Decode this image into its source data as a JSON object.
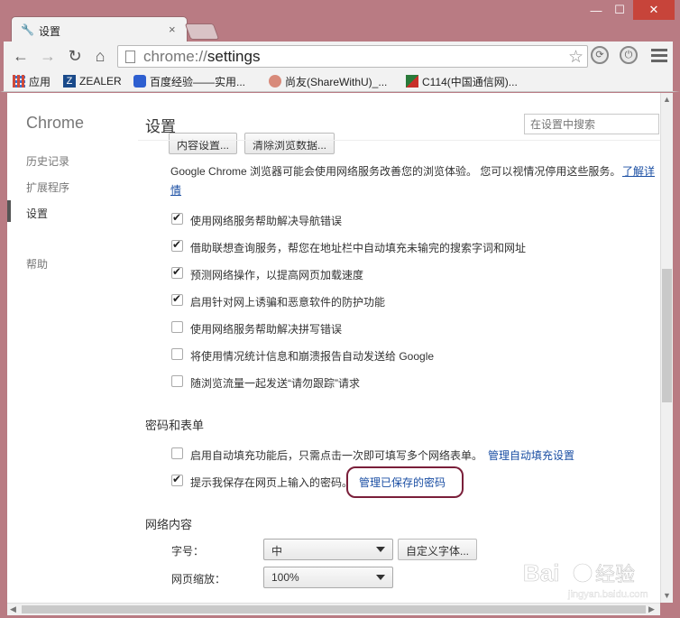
{
  "window": {
    "tab_title": "设置",
    "minimize": "—",
    "maximize": "☐",
    "close": "✕"
  },
  "toolbar": {
    "url_scheme": "chrome://",
    "url_path": "settings"
  },
  "bookmarks": [
    {
      "label": "应用",
      "icon": "apps-grid-icon"
    },
    {
      "label": "ZEALER",
      "icon": "zealer-icon"
    },
    {
      "label": "百度经验——实用...",
      "icon": "baidu-paw-icon"
    },
    {
      "label": "尚友(ShareWithU)_...",
      "icon": "sharewithu-icon"
    },
    {
      "label": "C114(中国通信网)...",
      "icon": "c114-icon"
    }
  ],
  "nav": {
    "brand": "Chrome",
    "items": [
      "历史记录",
      "扩展程序",
      "设置",
      "帮助"
    ]
  },
  "main": {
    "title": "设置",
    "search_placeholder": "在设置中搜索",
    "buttons_top": [
      "内容设置...",
      "清除浏览数据..."
    ],
    "privacy_note_1": "Google Chrome 浏览器可能会使用网络服务改善您的浏览体验。 您可以视情况停用这些服务。",
    "privacy_link_a": "了解详",
    "privacy_link_b": "情",
    "privacy_options": [
      {
        "label": "使用网络服务帮助解决导航错误",
        "checked": true
      },
      {
        "label": "借助联想查询服务，帮您在地址栏中自动填充未输完的搜索字词和网址",
        "checked": true
      },
      {
        "label": "预测网络操作，以提高网页加载速度",
        "checked": true
      },
      {
        "label": "启用针对网上诱骗和恶意软件的防护功能",
        "checked": true
      },
      {
        "label": "使用网络服务帮助解决拼写错误",
        "checked": false
      },
      {
        "label": "将使用情况统计信息和崩溃报告自动发送给 Google",
        "checked": false
      },
      {
        "label": "随浏览流量一起发送“请勿跟踪”请求",
        "checked": false
      }
    ],
    "passwords_section": "密码和表单",
    "autofill_label": "启用自动填充功能后，只需点击一次即可填写多个网络表单。",
    "autofill_checked": false,
    "autofill_link": "管理自动填充设置",
    "password_label": "提示我保存在网页上输入的密码。",
    "password_checked": true,
    "password_link": "管理已保存的密码",
    "web_content_section": "网络内容",
    "font_size_label": "字号：",
    "font_size_value": "中",
    "custom_fonts_button": "自定义字体...",
    "zoom_label": "网页缩放：",
    "zoom_value": "100%"
  },
  "watermark": {
    "brand": "Bai",
    "brand2": "经验",
    "url": "jingyan.baidu.com"
  }
}
